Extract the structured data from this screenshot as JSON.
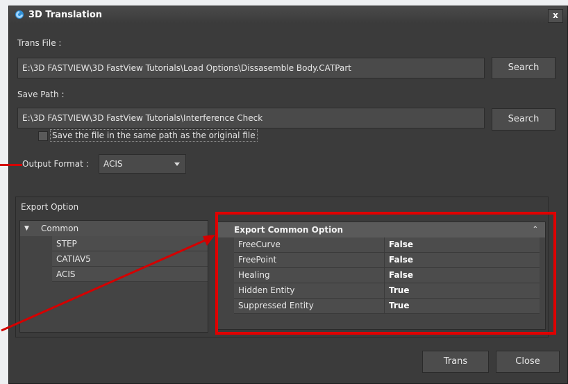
{
  "window": {
    "title": "3D Translation",
    "close_glyph": "x"
  },
  "trans_file": {
    "label": "Trans File :",
    "value": "E:\\3D FASTVIEW\\3D FastView Tutorials\\Load Options\\Dissasemble Body.CATPart",
    "search_label": "Search"
  },
  "save_path": {
    "label": "Save Path :",
    "value": "E:\\3D FASTVIEW\\3D FastView Tutorials\\Interference Check",
    "search_label": "Search",
    "same_path_checkbox_label": "Save the file in the same path as the original file",
    "same_path_checked": false
  },
  "output_format": {
    "label": "Output Format :",
    "selected": "ACIS"
  },
  "export_option": {
    "group_title": "Export Option",
    "tree": {
      "root_label": "Common",
      "expanded": true,
      "children": [
        "STEP",
        "CATIAV5",
        "ACIS"
      ]
    },
    "grid": {
      "header": "Export Common Option",
      "rows": [
        {
          "name": "FreeCurve",
          "value": "False"
        },
        {
          "name": "FreePoint",
          "value": "False"
        },
        {
          "name": "Healing",
          "value": "False"
        },
        {
          "name": "Hidden Entity",
          "value": "True"
        },
        {
          "name": "Suppressed Entity",
          "value": "True"
        }
      ]
    }
  },
  "footer": {
    "trans_label": "Trans",
    "close_label": "Close"
  },
  "annotation_color": "#e00000"
}
